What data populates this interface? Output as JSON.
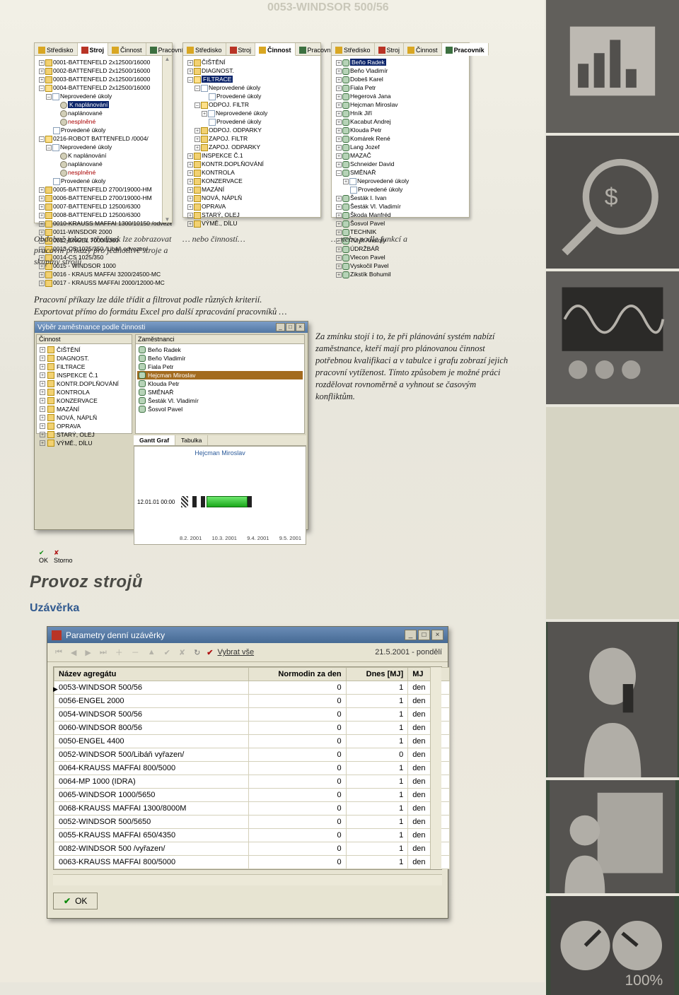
{
  "faint": {
    "t1": "0053-WINDSOR  500/56"
  },
  "tabs": {
    "stredisko": "Středisko",
    "stroj": "Stroj",
    "cinnost": "Činnost",
    "pracovnik": "Pracovník"
  },
  "panel1": {
    "items": [
      "0001-BATTENFELD 2x12500/16000",
      "0002-BATTENFELD 2x12500/16000",
      "0003-BATTENFELD 2x12500/16000",
      "0004-BATTENFELD 2x12500/16000"
    ],
    "sub4": {
      "neprov": "Neprovedené úkoly",
      "knap": "K naplánování",
      "naplan": "naplánované",
      "nespl": "nesplněné",
      "prov": "Provedené úkoly"
    },
    "robot": "0216-ROBOT BATTENFELD /0004/",
    "robot_sub": {
      "neprov": "Neprovedené úkoly",
      "knap": "K naplánování",
      "naplan": "naplánované",
      "nespl": "nesplněné",
      "prov": "Provedené úkoly"
    },
    "rest": [
      "0005-BATTENFELD 2700/19000-HM",
      "0006-BATTENFELD 2700/19000-HM",
      "0007-BATTENFELD 12500/6300",
      "0008-BATTENFELD 12500/6300",
      "0010-KRAUSS MAFFAI 1300/10150 /odvezen/",
      "0011-WINSDOR 2000",
      "0012-ENGEL 7000/1300",
      "0013-CS 1025/350 /Libáň odvezen/",
      "0014-CS 1025/350",
      "0015 - WINDSOR 1000",
      "0016 - KRAUS MAFFAI 3200/24500-MC",
      "0017 - KRAUSS MAFFAI 2000/12000-MC"
    ]
  },
  "panel2": {
    "items": [
      "ČIŠTĚNÍ",
      "DIAGNOST.",
      "FILTRACE"
    ],
    "filtrace": {
      "neprov": "Neprovedené úkoly",
      "prov": "Provedené úkoly",
      "odpoj_filtr": "ODPOJ. FILTR",
      "odpoj_filtr_sub": {
        "neprov": "Neprovedené úkoly",
        "prov": "Provedené úkoly"
      },
      "odpoj_odparky": "ODPOJ. ODPARKY",
      "zapoj_filtr": "ZAPOJ. FILTR",
      "zapoj_odparky": "ZAPOJ. ODPARKY"
    },
    "rest": [
      "INSPEKCE Č.1",
      "KONTR.DOPLŇOVÁNÍ",
      "KONTROLA",
      "KONZERVACE",
      "MAZÁNÍ",
      "NOVÁ, NÁPLŇ",
      "OPRAVA",
      "STARÝ, OLEJ",
      "VÝMĚ., DÍLU"
    ]
  },
  "panel3": {
    "items": [
      "Beňo Radek",
      "Beňo Vladimír",
      "Dobeš Karel",
      "Fiala Petr",
      "Hegerová Jana",
      "Hejcman Miroslav",
      "Hník Jiří",
      "Kacabut Andrej",
      "Klouda Petr",
      "Komárek René",
      "Lang Jozef",
      "MAZAČ",
      "Schneider David",
      "SMĚNAŘ"
    ],
    "smenar": {
      "neprov": "Neprovedené úkoly",
      "prov": "Provedené úkoly"
    },
    "rest": [
      "Šesták I. Ivan",
      "Šesták Vl. Vladimír",
      "Škoda Manfréd",
      "Šosvol Pavel",
      "TECHNIK",
      "Tulyk Anatoly",
      "ÚDRŽBÁŘ",
      "Vlecon Pavel",
      "Vyskočil Pavel",
      "Zikstík Bohumil"
    ]
  },
  "captions": {
    "c1": "Obdobně jako u středisek lze zobrazovat pracovní příkazy pro jednotlivé stroje a skupiny strojů",
    "c2": "… nebo činností…",
    "c3": "… nebo podle funkcí a"
  },
  "para1": "Pracovní příkazy lze dále třídit a filtrovat podle různých kriterií.\nExportovat přímo do formátu Excel pro další zpracování pracovníků …",
  "para2": "Za zmínku stojí i to, že při plánování systém nabízí zaměstnance, kteří mají pro plánovanou činnost potřebnou kvalifikaci a v tabulce i grafu zobrazí jejich pracovní vytíženost. Tímto způsobem je možné práci rozdělovat rovnoměrně a vyhnout se časovým konfliktům.",
  "dlg": {
    "title": "Výběr zaměstnance podle činnosti",
    "col1": "Činnost",
    "col2": "Zaměstnanci",
    "left": [
      "ČIŠTĚNÍ",
      "DIAGNOST.",
      "FILTRACE",
      "INSPEKCE Č.1",
      "KONTR.DOPLŇOVÁNÍ",
      "KONTROLA",
      "KONZERVACE",
      "MAZÁNÍ",
      "NOVÁ, NÁPLŇ",
      "OPRAVA",
      "STARÝ, OLEJ",
      "VÝMĚ., DÍLU"
    ],
    "right": [
      "Beňo Radek",
      "Beňo Vladimír",
      "Fiala Petr",
      "Hejcman Miroslav",
      "Klouda Petr",
      "SMĚNAŘ",
      "Šesták Vl. Vladimír",
      "Šosvol Pavel"
    ],
    "right_sel": "Hejcman Miroslav",
    "gtab_graf": "Gantt Graf",
    "gtab_tab": "Tabulka",
    "gantt_person": "Hejcman Miroslav",
    "gantt_row": "12.01.01 00:00",
    "gantt_axis": [
      "8.2. 2001",
      "10.3. 2001",
      "9.4. 2001",
      "9.5. 2001"
    ],
    "ok": "OK",
    "storno": "Storno"
  },
  "heading": "Provoz strojů",
  "subheading": "Uzávěrka",
  "win": {
    "title": "Parametry denní uzávěrky",
    "select_all": "Vybrat vše",
    "date": "21.5.2001 - pondělí",
    "cols": {
      "c1": "Název agregátu",
      "c2": "Normodin za den",
      "c3": "Dnes [MJ]",
      "c4": "MJ"
    },
    "rows": [
      {
        "n": "0053-WINDSOR  500/56",
        "a": "0",
        "b": "1",
        "u": "den"
      },
      {
        "n": "0056-ENGEL 2000",
        "a": "0",
        "b": "1",
        "u": "den"
      },
      {
        "n": "0054-WINDSOR  500/56",
        "a": "0",
        "b": "1",
        "u": "den"
      },
      {
        "n": "0060-WINDSOR 800/56",
        "a": "0",
        "b": "1",
        "u": "den"
      },
      {
        "n": "0050-ENGEL 4400",
        "a": "0",
        "b": "1",
        "u": "den"
      },
      {
        "n": "0052-WINDSOR 500/Libáň vyřazen/",
        "a": "0",
        "b": "0",
        "u": "den"
      },
      {
        "n": "0064-KRAUSS MAFFAI 800/5000",
        "a": "0",
        "b": "1",
        "u": "den"
      },
      {
        "n": "0064-MP 1000 (IDRA)",
        "a": "0",
        "b": "1",
        "u": "den"
      },
      {
        "n": "0065-WINDSOR 1000/5650",
        "a": "0",
        "b": "1",
        "u": "den"
      },
      {
        "n": "0068-KRAUSS MAFFAI 1300/8000M",
        "a": "0",
        "b": "1",
        "u": "den"
      },
      {
        "n": "0052-WINDSOR 500/5650",
        "a": "0",
        "b": "1",
        "u": "den"
      },
      {
        "n": "0055-KRAUSS MAFFAI 650/4350",
        "a": "0",
        "b": "1",
        "u": "den"
      },
      {
        "n": "0082-WINDSOR 500 /vyřazen/",
        "a": "0",
        "b": "1",
        "u": "den"
      },
      {
        "n": "0063-KRAUSS MAFFAI 800/5000",
        "a": "0",
        "b": "1",
        "u": "den"
      }
    ],
    "ok": "OK"
  },
  "chart_data": {
    "type": "bar",
    "title": "Hejcman Miroslav",
    "categories": [
      "8.2. 2001",
      "10.3. 2001",
      "9.4. 2001",
      "9.5. 2001"
    ],
    "series": [
      {
        "name": "12.01.01 00:00",
        "segments": [
          {
            "start": "8.2.2001",
            "end": "12.2.2001",
            "color": "#333"
          },
          {
            "start": "18.2.2001",
            "end": "20.2.2001",
            "color": "#333"
          },
          {
            "start": "26.2.2001",
            "end": "28.2.2001",
            "color": "#333"
          },
          {
            "start": "2.3.2001",
            "end": "28.3.2001",
            "color": "#3bcf3b"
          },
          {
            "start": "28.3.2001",
            "end": "30.3.2001",
            "color": "#333"
          }
        ]
      }
    ]
  }
}
